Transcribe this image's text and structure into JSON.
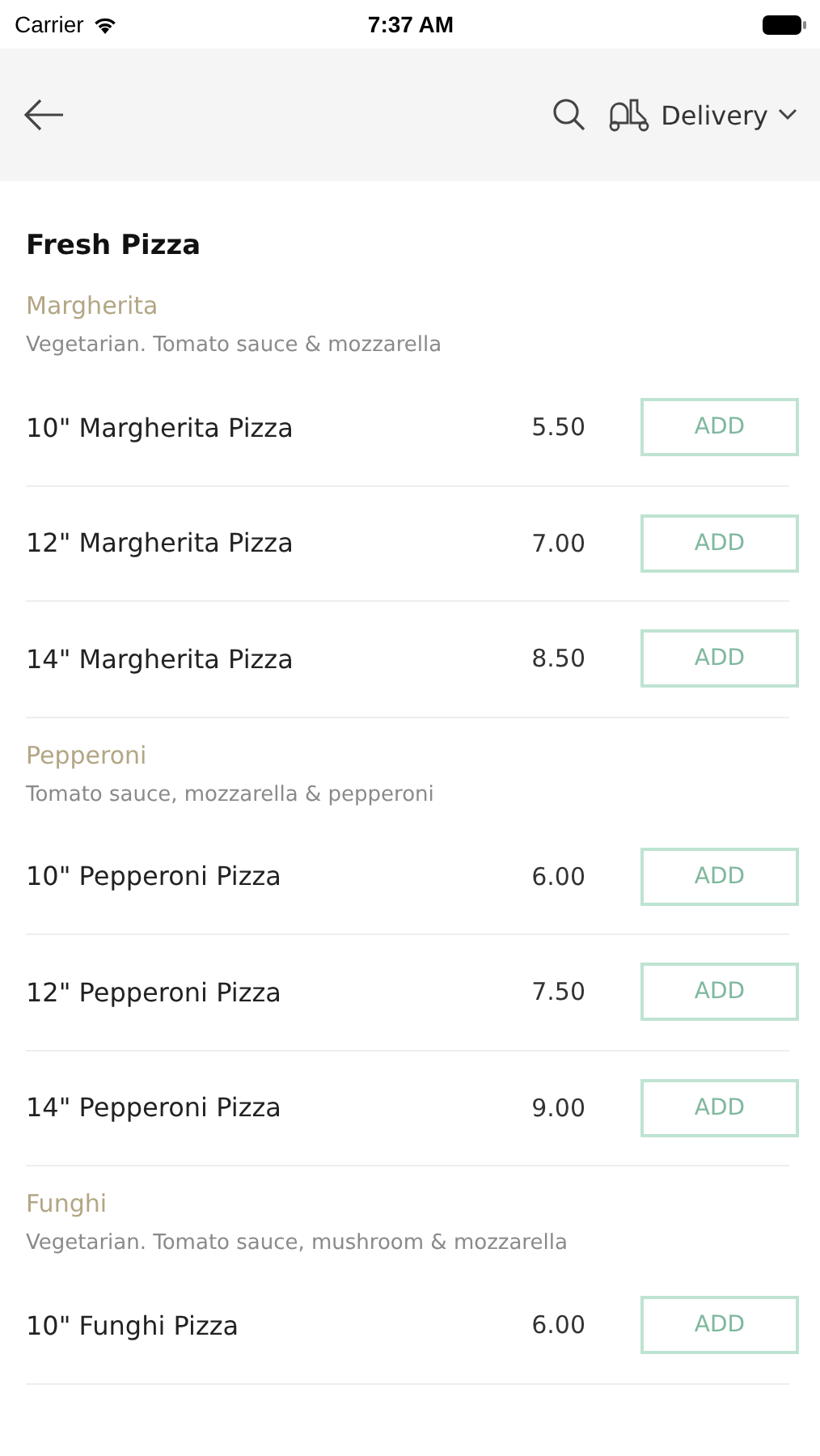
{
  "status_bar": {
    "carrier": "Carrier",
    "time": "7:37 AM"
  },
  "header": {
    "mode": "Delivery"
  },
  "section": {
    "title": "Fresh Pizza"
  },
  "groups": [
    {
      "name": "Margherita",
      "description": "Vegetarian. Tomato sauce & mozzarella",
      "items": [
        {
          "name": "10\" Margherita Pizza",
          "price": "5.50",
          "button": "ADD"
        },
        {
          "name": "12\" Margherita Pizza",
          "price": "7.00",
          "button": "ADD"
        },
        {
          "name": "14\" Margherita Pizza",
          "price": "8.50",
          "button": "ADD"
        }
      ]
    },
    {
      "name": "Pepperoni",
      "description": "Tomato sauce, mozzarella & pepperoni",
      "items": [
        {
          "name": "10\" Pepperoni Pizza",
          "price": "6.00",
          "button": "ADD"
        },
        {
          "name": "12\" Pepperoni Pizza",
          "price": "7.50",
          "button": "ADD"
        },
        {
          "name": "14\" Pepperoni Pizza",
          "price": "9.00",
          "button": "ADD"
        }
      ]
    },
    {
      "name": "Funghi",
      "description": "Vegetarian. Tomato sauce, mushroom & mozzarella",
      "items": [
        {
          "name": "10\" Funghi Pizza",
          "price": "6.00",
          "button": "ADD"
        }
      ]
    }
  ]
}
